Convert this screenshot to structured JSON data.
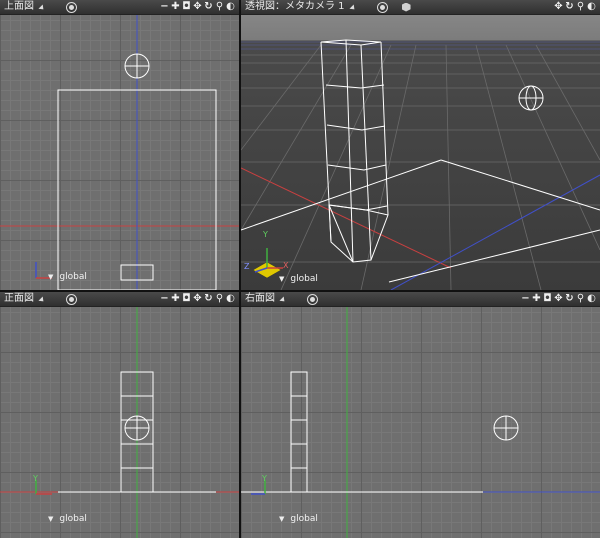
{
  "viewports": {
    "top": {
      "title": "上面図",
      "icons": [
        "target-icon",
        "move-icon",
        "zoom-in-icon",
        "camera-icon",
        "pan-icon",
        "rotate-icon",
        "magnifier-icon",
        "display-mode-icon"
      ],
      "global_label": "global"
    },
    "perspective": {
      "title": "透視図：メタカメラ 1",
      "icons": [
        "target-icon",
        "cube-icon",
        "pan-icon",
        "rotate-icon",
        "magnifier-icon",
        "display-mode-icon"
      ],
      "global_label": "global",
      "axis_labels": {
        "y": "Y",
        "x": "X",
        "z": "Z"
      }
    },
    "front": {
      "title": "正面図",
      "global_label": "global",
      "axis_labels": {
        "y": "Y"
      }
    },
    "right": {
      "title": "右面図",
      "global_label": "global",
      "axis_labels": {
        "y": "Y"
      }
    }
  },
  "colors": {
    "wire": "#ffffff",
    "x_axis": "#c84040",
    "y_axis": "#40b040",
    "z_axis": "#4050c8",
    "header": "#333333"
  }
}
